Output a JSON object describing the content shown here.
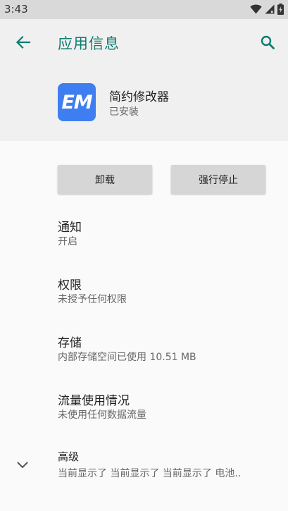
{
  "status_bar": {
    "time": "3:43",
    "icons": [
      "wifi-icon",
      "signal-icon",
      "battery-icon"
    ]
  },
  "header": {
    "title": "应用信息",
    "back_icon": "arrow-left-icon",
    "search_icon": "search-icon"
  },
  "app": {
    "icon_text": "EM",
    "name": "简约修改器",
    "status": "已安装",
    "icon_color": "#3f7ef0"
  },
  "actions": {
    "uninstall_label": "卸载",
    "force_stop_label": "强行停止"
  },
  "items": [
    {
      "title": "通知",
      "subtitle": "开启"
    },
    {
      "title": "权限",
      "subtitle": "未授予任何权限"
    },
    {
      "title": "存储",
      "subtitle": "内部存储空间已使用 10.51 MB"
    },
    {
      "title": "流量使用情况",
      "subtitle": "未使用任何数据流量"
    },
    {
      "title": "高级",
      "subtitle": "当前显示了 当前显示了 当前显示了 电池.."
    }
  ],
  "colors": {
    "accent": "#0d7d6e",
    "status_bar": "#d9d9d9",
    "header_bg": "#f0f0f0",
    "body_bg": "#fafafa",
    "button_bg": "#d6d6d6"
  }
}
